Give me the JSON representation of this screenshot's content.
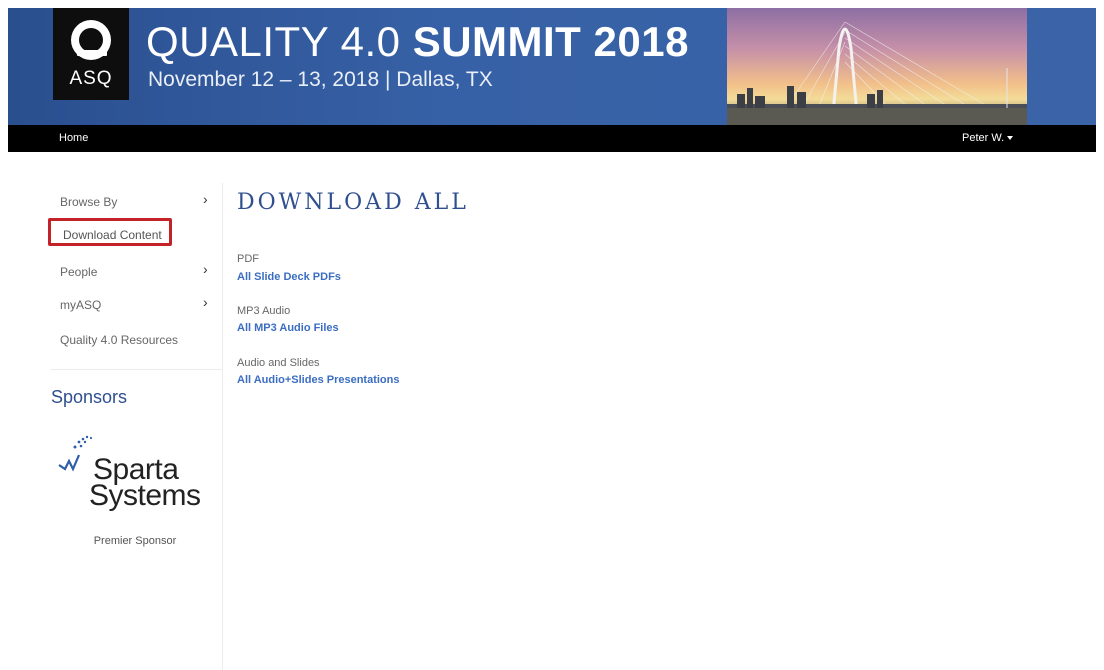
{
  "banner": {
    "logo_text": "ASQ",
    "title_light": "QUALITY 4.0 ",
    "title_bold": "SUMMIT 2018",
    "subtitle": "November 12 – 13, 2018  |  Dallas, TX"
  },
  "nav": {
    "home_label": "Home",
    "user_label": "Peter W."
  },
  "sidebar": {
    "items": [
      {
        "label": "Browse By",
        "has_chevron": true
      },
      {
        "label": "Download Content",
        "active": true
      },
      {
        "label": "People",
        "has_chevron": true
      },
      {
        "label": "myASQ",
        "has_chevron": true
      },
      {
        "label": "Quality 4.0 Resources"
      }
    ],
    "chevron_glyph": "›",
    "sponsors_title": "Sponsors",
    "sponsor": {
      "name_line1": "Sparta",
      "name_line2": "Systems",
      "caption": "Premier Sponsor"
    }
  },
  "main": {
    "title": "DOWNLOAD ALL",
    "sections": [
      {
        "label": "PDF",
        "link": "All Slide Deck PDFs"
      },
      {
        "label": "MP3 Audio",
        "link": "All MP3 Audio Files"
      },
      {
        "label": "Audio and Slides",
        "link": "All Audio+Slides Presentations"
      }
    ]
  },
  "colors": {
    "banner_blue": "#3761a6",
    "link_blue": "#3b6dc1",
    "highlight_red": "#c22228"
  }
}
